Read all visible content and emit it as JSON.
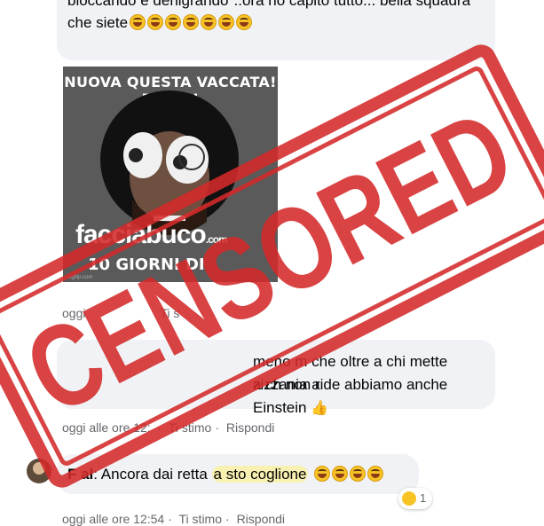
{
  "comment1": {
    "line1": "bloccando e denigrando\"..ora ho capito tutto... bella squadra",
    "line2": "che siete"
  },
  "meme": {
    "top_text": "NUOVA QUESTA VACCATA! BELLA!",
    "brand": "facciabuco",
    "brand_suffix": ".com",
    "bottom_text": "10 GIORNI DI",
    "credit": "imgflip.com"
  },
  "meta1": {
    "time": "oggi",
    "like": "Ti s"
  },
  "comment2": {
    "line1": "meno m   che oltre a chi mette zizzania a",
    "line2": "a ch  non ride abbiamo anche Einstein"
  },
  "meta2": {
    "time": "oggi alle ore 12:  ",
    "like": "Ti stimo",
    "reply": "Rispondi"
  },
  "comment3": {
    "author": "F    al",
    "text_before": ": Ancora dai retta ",
    "highlight": "a sto coglione"
  },
  "reaction": {
    "count": "1"
  },
  "meta3": {
    "time": "oggi alle ore 12:54",
    "like": "Ti stimo",
    "reply": "Rispondi"
  },
  "stamp": {
    "text": "CENSORED",
    "color": "#d42a2a"
  }
}
